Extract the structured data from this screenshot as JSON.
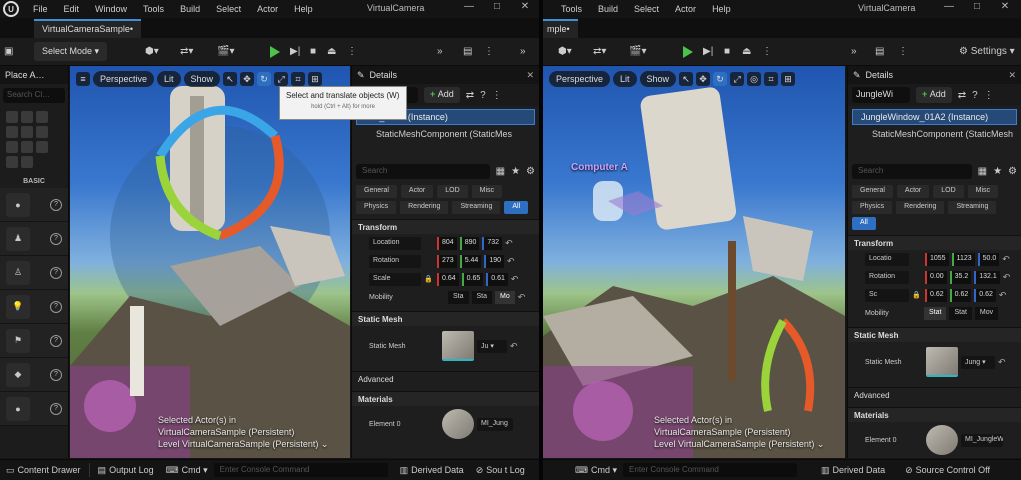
{
  "menu": [
    "File",
    "Edit",
    "Window",
    "Tools",
    "Build",
    "Select",
    "Actor",
    "Help"
  ],
  "menu_b": [
    "Tools",
    "Build",
    "Select",
    "Actor",
    "Help"
  ],
  "logo": "U",
  "window_title": "VirtualCamera",
  "window_controls": [
    "—",
    "□",
    "✕"
  ],
  "tab_a": "VirtualCameraSample•",
  "tab_b": "mple•",
  "select_mode": "Select Mode ▾",
  "settings": "⚙ Settings ▾",
  "place_actors": "Place A…",
  "left_search": "Search Cl…",
  "basic": "BASIC",
  "viewport": {
    "perspective": "Perspective",
    "lit": "Lit",
    "show": "Show",
    "selected_line1": "Selected Actor(s) in",
    "selected_line2": "VirtualCameraSample (Persistent)",
    "level_line": "Level  VirtualCameraSample (Persistent)  ⌄",
    "computer_label": "Computer A"
  },
  "tooltip": {
    "title": "Select and translate objects (W)",
    "hint": "hold (Ctrl + Alt) for more"
  },
  "details_a": {
    "tab": "Details",
    "name": "Wa",
    "add": "Add",
    "instance": "Vall_01B6 (Instance)",
    "component": "StaticMeshComponent (StaticMes",
    "search": "Search",
    "cats": [
      "General",
      "Actor",
      "LOD",
      "Misc",
      "Physics",
      "Rendering",
      "Streaming",
      "All"
    ],
    "transform": "Transform",
    "location": [
      "Location",
      "804",
      "890",
      "732"
    ],
    "rotation": [
      "Rotation",
      "273",
      "5.44",
      "190"
    ],
    "scale": [
      "Scale",
      "0.64",
      "0.65",
      "0.61"
    ],
    "mobility": [
      "Mobility",
      "Sta",
      "Sta",
      "Mo"
    ],
    "static_mesh_sect": "Static Mesh",
    "static_mesh_label": "Static Mesh",
    "mesh_drop": "Ju ▾",
    "advanced": "Advanced",
    "materials": "Materials",
    "element0": "Element 0",
    "mat_name": "MI_Jung"
  },
  "details_b": {
    "tab": "Details",
    "name": "JungleWi",
    "add": "Add",
    "instance": "JungleWindow_01A2 (Instance)",
    "component": "StaticMeshComponent (StaticMesh",
    "search": "Search",
    "cats": [
      "General",
      "Actor",
      "LOD",
      "Misc",
      "Physics",
      "Rendering",
      "Streaming",
      "All"
    ],
    "transform": "Transform",
    "location": [
      "Locatio",
      "1055",
      "1123",
      "50.0"
    ],
    "rotation": [
      "Rotation",
      "0.00",
      "35.2",
      "132.1"
    ],
    "scale": [
      "Sc",
      "0.62",
      "0.62",
      "0.62"
    ],
    "mobility": [
      "Mobility",
      "Stat",
      "Stat",
      "Mov"
    ],
    "static_mesh_sect": "Static Mesh",
    "static_mesh_label": "Static Mesh",
    "mesh_drop": "Jung ▾",
    "advanced": "Advanced",
    "materials": "Materials",
    "element0": "Element 0",
    "mat_name": "MI_JungleW"
  },
  "bottom_a": {
    "content_drawer": "Content Drawer",
    "output_log": "Output Log",
    "cmd": "Cmd ▾",
    "console": "Enter Console Command",
    "derived": "Derived Data",
    "source": "Sou t Log"
  },
  "bottom_b": {
    "cmd": "Cmd ▾",
    "console": "Enter Console Command",
    "derived": "Derived Data",
    "source": "Source Control Off"
  }
}
